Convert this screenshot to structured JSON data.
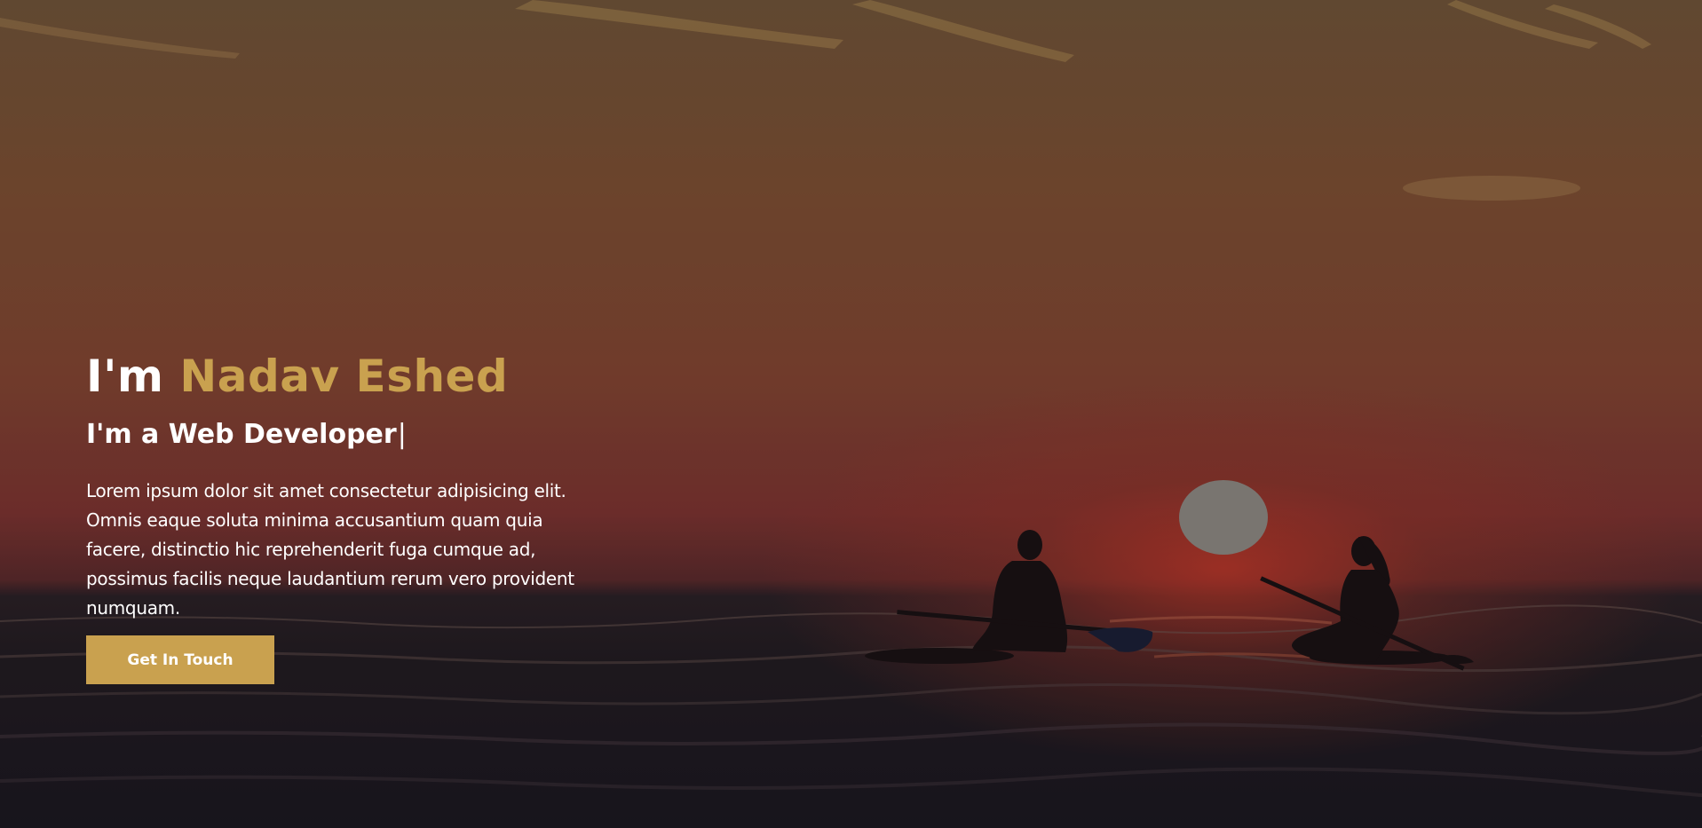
{
  "hero": {
    "greeting": "I'm ",
    "name": "Nadav Eshed",
    "role": "I'm a Web Developer",
    "cursor": "|",
    "description": "Lorem ipsum dolor sit amet consectetur adipisicing elit. Omnis eaque soluta minima accusantium quam quia facere, distinctio hic reprehenderit fuga cumque ad, possimus facilis neque laudantium rerum vero provident numquam.",
    "cta_label": "Get In Touch",
    "background_image": "sunset-sea-paddleboarders"
  },
  "colors": {
    "accent": "#c9a14f",
    "text": "#ffffff"
  }
}
